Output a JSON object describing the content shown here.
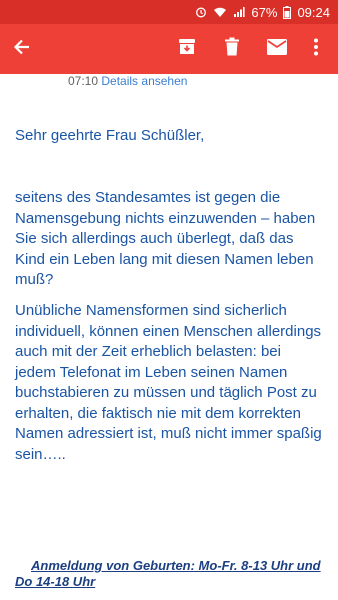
{
  "status_bar": {
    "battery": "67%",
    "time": "09:24",
    "icons": [
      "alarm-icon",
      "wifi-icon",
      "signal-icon",
      "battery-icon"
    ]
  },
  "toolbar": {
    "icons": [
      "back-arrow-icon",
      "archive-icon",
      "delete-icon",
      "mail-icon",
      "more-vert-icon"
    ]
  },
  "message": {
    "time": "07:10",
    "details_link": "Details ansehen",
    "greeting": "Sehr geehrte Frau Schüßler,",
    "paragraph1": "seitens des Standesamtes ist gegen die Namensgebung nichts einzuwenden – haben Sie sich allerdings auch überlegt, daß das Kind ein Leben lang mit diesen Namen leben muß?",
    "paragraph2": "Unübliche Namensformen sind sicherlich individuell, können einen Menschen allerdings auch mit der Zeit erheblich belasten: bei jedem Telefonat im Leben seinen Namen buchstabieren zu müssen und täglich Post zu erhalten, die faktisch nie mit dem korrekten Namen adressiert ist, muß nicht immer spaßig sein…..",
    "footer_line1": "Anmeldung von Geburten: Mo-Fr. 8-13 Uhr und",
    "footer_line2": "Do 14-18 Uhr"
  },
  "colors": {
    "status_bar": "#d83028",
    "app_bar": "#ee4036",
    "body_text": "#1a55a5",
    "link": "#3b7fd0"
  }
}
